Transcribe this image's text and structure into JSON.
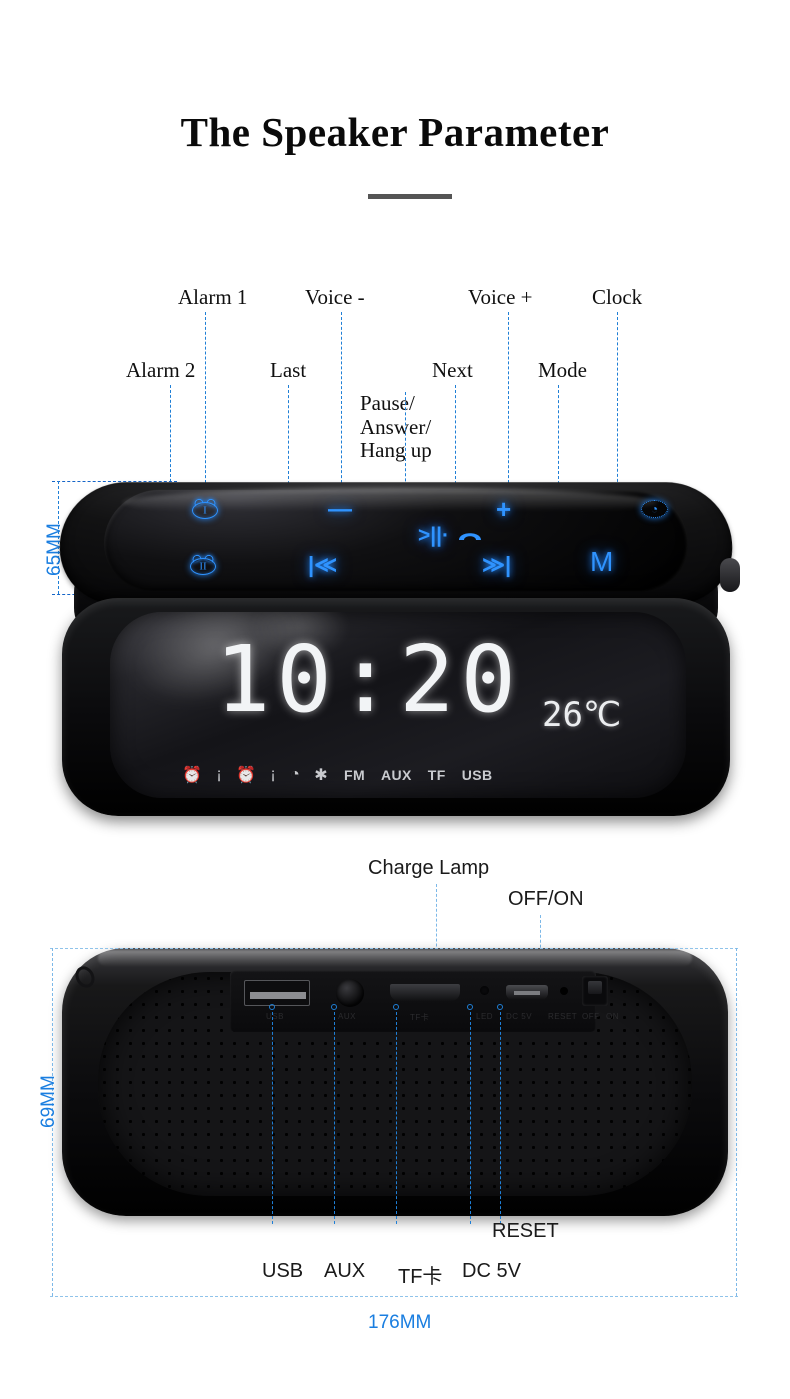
{
  "header": {
    "title": "The Speaker Parameter"
  },
  "top_view": {
    "callouts": {
      "alarm1": "Alarm 1",
      "alarm2": "Alarm 2",
      "last": "Last",
      "voice_minus": "Voice -",
      "pause_answer": "Pause/\nAnswer/\nHang up",
      "next": "Next",
      "voice_plus": "Voice +",
      "mode": "Mode",
      "clock": "Clock"
    },
    "touch_buttons": {
      "alarm1_icon": "alarm-clock-1-icon",
      "alarm1_numeral": "I",
      "alarm2_icon": "alarm-clock-2-icon",
      "alarm2_numeral": "II",
      "volume_down": "—",
      "previous_track": "|≪",
      "play_pause_answer": ">||·",
      "phone_icon": "phone-handset-icon",
      "next_track": "≫|",
      "volume_up": "+",
      "mode": "M",
      "clock_icon": "clock-icon",
      "clock_glyph": "◔"
    },
    "dimension_height": "65MM"
  },
  "display": {
    "time": "10:20",
    "temperature": "26℃",
    "status_icons": [
      {
        "name": "alarm-1-icon",
        "glyph": "⏰"
      },
      {
        "name": "alarm-1-indicator-icon",
        "glyph": "¡"
      },
      {
        "name": "alarm-2-icon",
        "glyph": "⏰"
      },
      {
        "name": "alarm-2-indicator-icon",
        "glyph": "¡"
      },
      {
        "name": "snooze-icon",
        "glyph": "◔"
      },
      {
        "name": "bluetooth-icon",
        "glyph": "✱"
      }
    ],
    "status_labels": [
      "FM",
      "AUX",
      "TF",
      "USB"
    ]
  },
  "rear_view": {
    "callouts": {
      "charge_lamp": "Charge Lamp",
      "off_on": "OFF/ON",
      "reset": "RESET",
      "usb": "USB",
      "aux": "AUX",
      "tf_card": "TF卡",
      "dc_5v": "DC 5V"
    },
    "port_labels": {
      "usb": "USB",
      "aux": "AUX",
      "tf": "TF卡",
      "led": "LED",
      "dc": "DC 5V",
      "reset": "RESET",
      "off": "OFF",
      "on": "ON"
    },
    "dimension_height": "69MM",
    "dimension_width": "176MM"
  },
  "colors": {
    "accent_blue": "#1a7ee0",
    "leader_blue": "#1f7fd6",
    "leader_blue_pale": "#8fc3ea",
    "glow_blue": "#2f93ff",
    "title_rule": "#555555"
  }
}
